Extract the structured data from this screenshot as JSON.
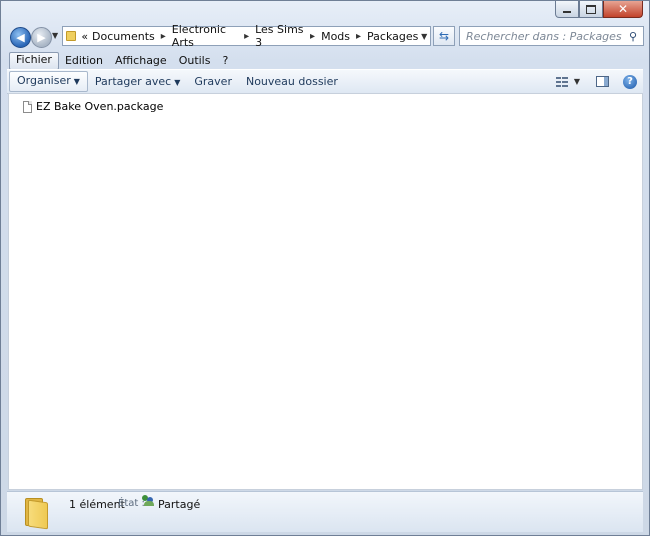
{
  "window": {
    "caption": {
      "minimize": "minimize",
      "maximize": "maximize",
      "close": "✕"
    }
  },
  "nav": {
    "address": {
      "overflow": "«",
      "breadcrumbs": [
        "Documents",
        "Electronic Arts",
        "Les Sims 3",
        "Mods",
        "Packages"
      ]
    },
    "search": {
      "placeholder": "Rechercher dans : Packages"
    }
  },
  "menu": {
    "items": [
      "Fichier",
      "Edition",
      "Affichage",
      "Outils",
      "?"
    ]
  },
  "toolbar": {
    "organize": "Organiser",
    "share": "Partager avec",
    "burn": "Graver",
    "new_folder": "Nouveau dossier",
    "help": "?"
  },
  "files": [
    {
      "name": "EZ Bake Oven.package",
      "icon": "document-icon"
    }
  ],
  "details": {
    "count": "1 élément",
    "state_label": "État :",
    "state_value": "Partagé"
  }
}
